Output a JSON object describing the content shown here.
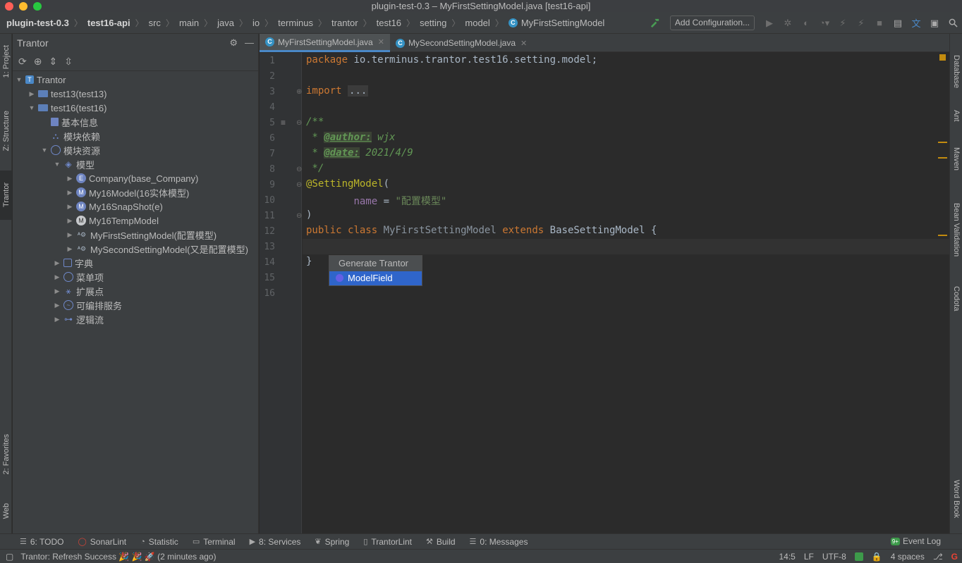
{
  "window": {
    "title": "plugin-test-0.3 – MyFirstSettingModel.java [test16-api]",
    "traffic_colors": [
      "#fe5f57",
      "#febc2e",
      "#28c840"
    ]
  },
  "breadcrumbs": [
    "plugin-test-0.3",
    "test16-api",
    "src",
    "main",
    "java",
    "io",
    "terminus",
    "trantor",
    "test16",
    "setting",
    "model",
    "MyFirstSettingModel"
  ],
  "toolbar": {
    "add_configuration": "Add Configuration..."
  },
  "left_strip": {
    "project": "1: Project",
    "structure": "Z: Structure",
    "trantor": "Trantor",
    "favorites": "2: Favorites",
    "web": "Web"
  },
  "panel": {
    "title": "Trantor",
    "tree": [
      {
        "label": "Trantor",
        "level": 0,
        "expanded": true,
        "icon": "trantor-icon"
      },
      {
        "label": "test13(test13)",
        "level": 1,
        "expanded": false,
        "icon": "folder-icon"
      },
      {
        "label": "test16(test16)",
        "level": 1,
        "expanded": true,
        "icon": "folder-icon"
      },
      {
        "label": "基本信息",
        "level": 2,
        "expanded": null,
        "icon": "info-icon"
      },
      {
        "label": "模块依赖",
        "level": 2,
        "expanded": null,
        "icon": "dependency-icon"
      },
      {
        "label": "模块资源",
        "level": 2,
        "expanded": true,
        "icon": "resource-icon"
      },
      {
        "label": "模型",
        "level": 3,
        "expanded": true,
        "icon": "model-icon"
      },
      {
        "label": "Company(base_Company)",
        "level": 4,
        "expanded": false,
        "icon": "entity-icon",
        "badge": "E"
      },
      {
        "label": "My16Model(16实体模型)",
        "level": 4,
        "expanded": false,
        "icon": "entity-icon",
        "badge": "M"
      },
      {
        "label": "My16SnapShot(e)",
        "level": 4,
        "expanded": false,
        "icon": "entity-icon",
        "badge": "M"
      },
      {
        "label": "My16TempModel",
        "level": 4,
        "expanded": false,
        "icon": "temp-model-icon",
        "badge": "M"
      },
      {
        "label": "MyFirstSettingModel(配置模型)",
        "level": 4,
        "expanded": false,
        "icon": "setting-model-icon"
      },
      {
        "label": "MySecondSettingModel(又是配置模型)",
        "level": 4,
        "expanded": false,
        "icon": "setting-model-icon"
      },
      {
        "label": "字典",
        "level": 3,
        "expanded": false,
        "icon": "dictionary-icon"
      },
      {
        "label": "菜单项",
        "level": 3,
        "expanded": false,
        "icon": "menu-icon"
      },
      {
        "label": "扩展点",
        "level": 3,
        "expanded": false,
        "icon": "extension-icon"
      },
      {
        "label": "可编排服务",
        "level": 3,
        "expanded": false,
        "icon": "service-icon"
      },
      {
        "label": "逻辑流",
        "level": 3,
        "expanded": false,
        "icon": "flow-icon"
      }
    ]
  },
  "tabs": [
    {
      "label": "MyFirstSettingModel.java",
      "active": true
    },
    {
      "label": "MySecondSettingModel.java",
      "active": false
    }
  ],
  "code": {
    "line_numbers": [
      "1",
      "2",
      "3",
      "4",
      "5",
      "6",
      "7",
      "8",
      "9",
      "10",
      "11",
      "12",
      "13",
      "14",
      "15",
      "16"
    ],
    "pkg_kw": "package",
    "pkg_name": "io.terminus.trantor.test16.setting.model;",
    "import_kw": "import",
    "import_fold": "...",
    "doc_open": "/**",
    "doc_star": " * ",
    "author_tag": "@author:",
    "author_val": " wjx",
    "date_tag": "@date:",
    "date_val": " 2021/4/9",
    "doc_close": " */",
    "annotation": "@SettingModel",
    "paren_open": "(",
    "name_field": "name",
    "name_eq": " = ",
    "name_val": "\"配置模型\"",
    "paren_close": ")",
    "public_kw": "public",
    "class_kw": "class",
    "class_name": "MyFirstSettingModel",
    "extends_kw": "extends",
    "base_class": "BaseSettingModel",
    "brace_open": "{",
    "brace_close": "}"
  },
  "popup": {
    "title": "Generate Trantor",
    "item": "ModelField"
  },
  "right_strip": {
    "database": "Database",
    "ant": "Ant",
    "maven": "Maven",
    "bean_validation": "Bean Validation",
    "codota": "Codota",
    "word_book": "Word Book"
  },
  "bottom_tools": [
    {
      "label": "6: TODO",
      "icon": "todo-icon"
    },
    {
      "label": "SonarLint",
      "icon": "sonarlint-icon"
    },
    {
      "label": "Statistic",
      "icon": "statistic-icon"
    },
    {
      "label": "Terminal",
      "icon": "terminal-icon"
    },
    {
      "label": "8: Services",
      "icon": "services-icon"
    },
    {
      "label": "Spring",
      "icon": "spring-icon"
    },
    {
      "label": "TrantorLint",
      "icon": "trantorlint-icon"
    },
    {
      "label": "Build",
      "icon": "build-icon"
    },
    {
      "label": "0: Messages",
      "icon": "messages-icon"
    }
  ],
  "event_log": "Event Log",
  "event_badge": "9+",
  "status": {
    "message": "Trantor: Refresh Success 🎉 🎉 🚀 (2 minutes ago)",
    "position": "14:5",
    "line_sep": "LF",
    "encoding": "UTF-8",
    "indent": "4 spaces"
  }
}
